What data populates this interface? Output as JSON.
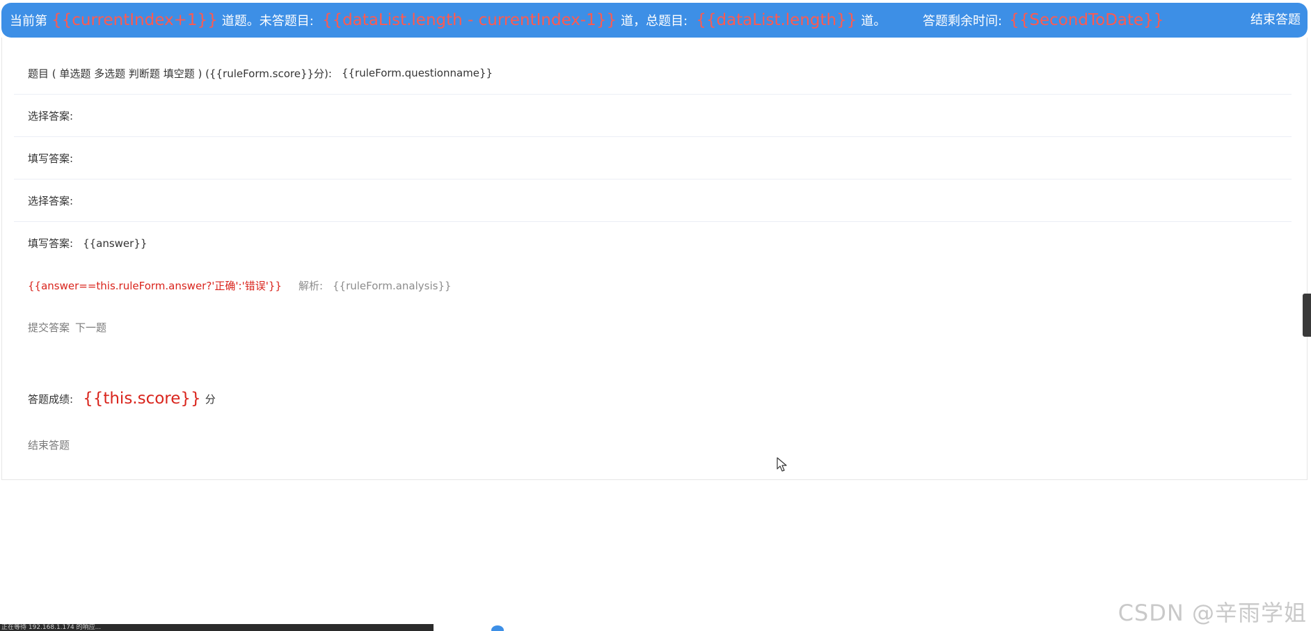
{
  "header": {
    "prefix": "当前第",
    "current_expr": "{{currentIndex+1}}",
    "after_current": "道题。未答题目:",
    "remaining_expr": "{{dataList.length - currentIndex-1}}",
    "after_remaining": "道，总题目:",
    "total_expr": "{{dataList.length}}",
    "after_total": "道。",
    "time_label": "答题剩余时间:",
    "time_expr": "{{SecondToDate}}",
    "end_button": "结束答题"
  },
  "question": {
    "label": "题目 ( 单选题 多选题 判断题 填空题 ) ({{ruleForm.score}}分):",
    "value": "{{ruleForm.questionname}}"
  },
  "answer_rows": [
    {
      "label": "选择答案:"
    },
    {
      "label": "填写答案:"
    },
    {
      "label": "选择答案:"
    },
    {
      "label": "填写答案:",
      "value": "{{answer}}"
    }
  ],
  "result": {
    "verdict_expr": "{{answer==this.ruleForm.answer?'正确':'错误'}}",
    "analysis_label": "解析:",
    "analysis_value": "{{ruleForm.analysis}}"
  },
  "actions": {
    "submit": "提交答案",
    "next": "下一题"
  },
  "score": {
    "label": "答题成绩:",
    "value_expr": "{{this.score}}",
    "unit": "分"
  },
  "footer_end_button": "结束答题",
  "watermark": "CSDN @辛雨学姐",
  "statusbar_text": "正在等待 192.168.1.174 的响应...",
  "colors": {
    "header_bg": "#3d8fe6",
    "highlight_red": "#ff5a4f",
    "verdict_red": "#d9241c"
  }
}
